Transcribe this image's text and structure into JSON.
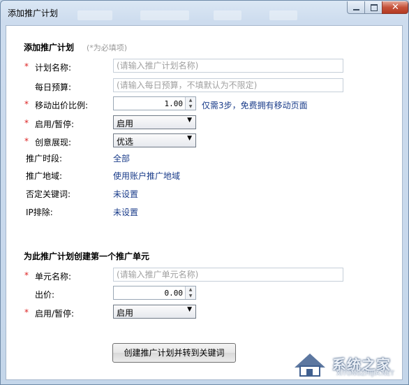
{
  "window": {
    "title": "添加推广计划"
  },
  "plan_section": {
    "title": "添加推广计划",
    "hint": "(*为必填项)",
    "fields": {
      "plan_name": {
        "label": "计划名称:",
        "placeholder": "(请输入推广计划名称)",
        "required_mark": "*"
      },
      "daily_budget": {
        "label": "每日预算:",
        "placeholder": "(请输入每日预算，不填默认为不限定)"
      },
      "mobile_ratio": {
        "label": "移动出价比例:",
        "value": "1.00",
        "required_mark": "*",
        "promo_link": "仅需3步，免费拥有移动页面"
      },
      "status": {
        "label": "启用/暂停:",
        "value": "启用",
        "required_mark": "*"
      },
      "creative_display": {
        "label": "创意展现:",
        "value": "优选",
        "required_mark": "*"
      },
      "schedule": {
        "label": "推广时段:",
        "value": "全部"
      },
      "region": {
        "label": "推广地域:",
        "value": "使用账户推广地域"
      },
      "negative_keywords": {
        "label": "否定关键词:",
        "value": "未设置"
      },
      "ip_exclusion": {
        "label": "IP排除:",
        "value": "未设置"
      }
    }
  },
  "unit_section": {
    "title": "为此推广计划创建第一个推广单元",
    "fields": {
      "unit_name": {
        "label": "单元名称:",
        "placeholder": "(请输入推广单元名称)",
        "required_mark": "*"
      },
      "bid": {
        "label": "出价:",
        "value": "0.00"
      },
      "status": {
        "label": "启用/暂停:",
        "value": "启用",
        "required_mark": "*"
      }
    }
  },
  "actions": {
    "create_button": "创建推广计划并转到关键词"
  },
  "watermark": {
    "text": "系统之家",
    "url": "XITONGZHIJIA.NET"
  },
  "colors": {
    "required": "#dd2222",
    "link": "#1a3c8a",
    "hint": "#9a9a9a"
  }
}
